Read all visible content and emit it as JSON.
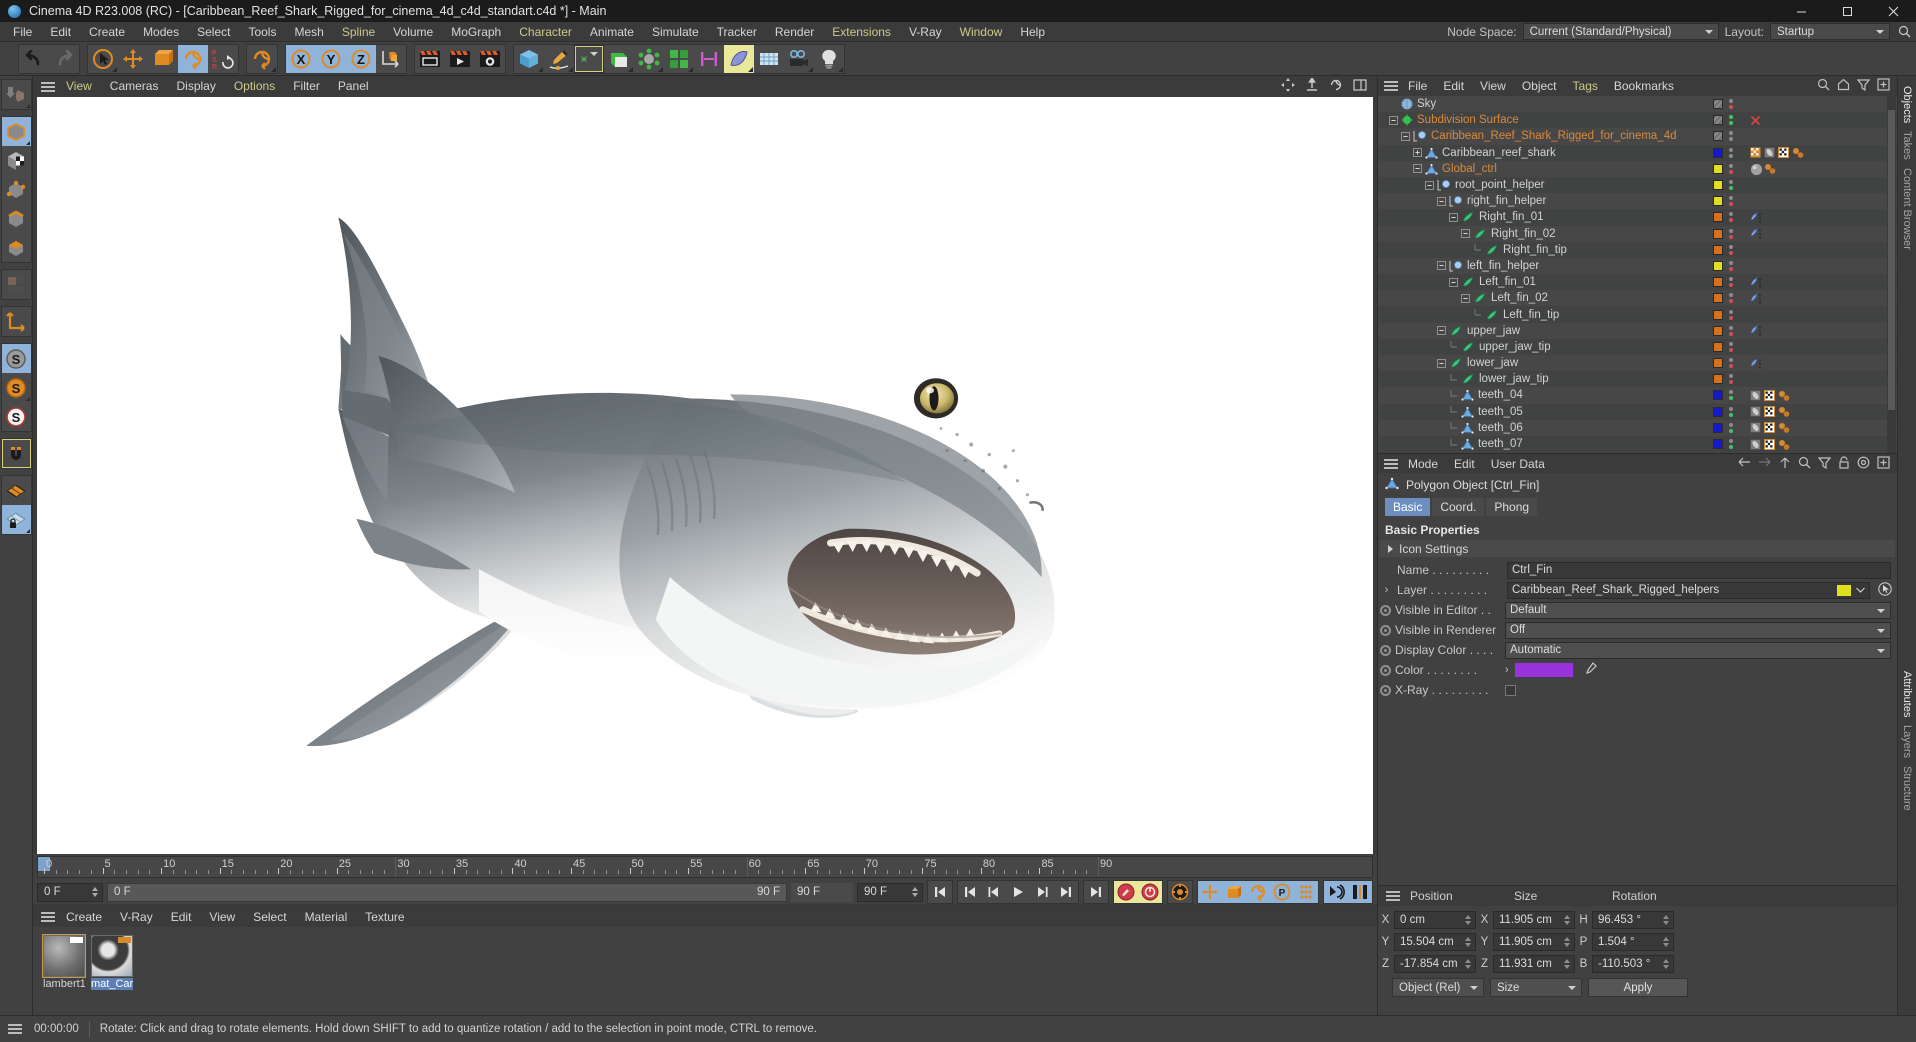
{
  "titlebar": {
    "title": "Cinema 4D R23.008 (RC) - [Caribbean_Reef_Shark_Rigged_for_cinema_4d_c4d_standart.c4d *] - Main",
    "minimize": "–",
    "maximize": "□",
    "close": "✕"
  },
  "menubar": {
    "items": [
      {
        "label": "File"
      },
      {
        "label": "Edit"
      },
      {
        "label": "Create"
      },
      {
        "label": "Modes"
      },
      {
        "label": "Select"
      },
      {
        "label": "Tools"
      },
      {
        "label": "Mesh"
      },
      {
        "label": "Spline",
        "accent": true
      },
      {
        "label": "Volume"
      },
      {
        "label": "MoGraph"
      },
      {
        "label": "Character",
        "accent": true
      },
      {
        "label": "Animate"
      },
      {
        "label": "Simulate"
      },
      {
        "label": "Tracker"
      },
      {
        "label": "Render"
      },
      {
        "label": "Extensions",
        "accent": true
      },
      {
        "label": "V-Ray"
      },
      {
        "label": "Window",
        "accent": true
      },
      {
        "label": "Help"
      }
    ],
    "node_space_label": "Node Space:",
    "node_space_value": "Current (Standard/Physical)",
    "layout_label": "Layout:",
    "layout_value": "Startup"
  },
  "toolbar": {
    "groups": [
      {
        "buttons": [
          {
            "name": "undo-icon",
            "state": "normal"
          },
          {
            "name": "redo-icon",
            "state": "disabled"
          }
        ]
      },
      {
        "buttons": [
          {
            "name": "select-live-icon",
            "state": "corner"
          },
          {
            "name": "move-icon",
            "state": "normal"
          },
          {
            "name": "scale-icon",
            "state": "normal"
          },
          {
            "name": "rotate-icon",
            "state": "on"
          },
          {
            "name": "psr-icon",
            "state": "normal"
          }
        ]
      },
      {
        "buttons": [
          {
            "name": "world-object-axis-icon",
            "state": "corner"
          }
        ]
      },
      {
        "buttons": [
          {
            "name": "x-axis-lock-icon",
            "state": "on"
          },
          {
            "name": "y-axis-lock-icon",
            "state": "on"
          },
          {
            "name": "z-axis-lock-icon",
            "state": "on"
          },
          {
            "name": "world-coordinate-icon",
            "state": "normal"
          }
        ]
      },
      {
        "buttons": [
          {
            "name": "render-view-icon",
            "state": "normal"
          },
          {
            "name": "render-to-picture-viewer-icon",
            "state": "normal"
          },
          {
            "name": "render-settings-icon",
            "state": "normal"
          }
        ]
      },
      {
        "buttons": [
          {
            "name": "cube-primitive-icon",
            "state": "corner"
          },
          {
            "name": "spline-pen-icon",
            "state": "corner"
          },
          {
            "name": "generator-icon",
            "state": "selected"
          },
          {
            "name": "bend-deformer-icon",
            "state": "corner"
          },
          {
            "name": "scene-objects-icon",
            "state": "corner"
          },
          {
            "name": "mograph-cloner-icon",
            "state": "corner"
          },
          {
            "name": "measure-icon",
            "state": "normal"
          },
          {
            "name": "deformer-icon",
            "state": "ony"
          },
          {
            "name": "floor-environment-icon",
            "state": "normal"
          },
          {
            "name": "camera-icon",
            "state": "corner"
          },
          {
            "name": "light-icon",
            "state": "corner"
          }
        ]
      }
    ]
  },
  "leftbar": {
    "groups": [
      {
        "buttons": [
          {
            "name": "make-editable-icon",
            "state": "corner"
          }
        ]
      },
      {
        "buttons": [
          {
            "name": "model-mode-icon",
            "state": "on"
          },
          {
            "name": "texture-mode-icon",
            "state": "normal"
          },
          {
            "name": "point-mode-icon",
            "state": "normal"
          },
          {
            "name": "edge-mode-icon",
            "state": "normal"
          },
          {
            "name": "polygon-mode-icon",
            "state": "normal"
          }
        ]
      },
      {
        "buttons": [
          {
            "name": "uv-mode-icon",
            "state": "disabled"
          }
        ]
      },
      {
        "buttons": [
          {
            "name": "axis-modify-icon",
            "state": "normal"
          }
        ]
      },
      {
        "buttons": [
          {
            "name": "enable-snap-gray-icon",
            "state": "on"
          },
          {
            "name": "snap-settings-icon",
            "state": "corner"
          },
          {
            "name": "snap-3d-icon",
            "state": "normal"
          }
        ]
      },
      {
        "buttons": [
          {
            "name": "magnet-icon",
            "state": "selected"
          }
        ]
      },
      {
        "buttons": [
          {
            "name": "workplane-icon",
            "state": "normal"
          },
          {
            "name": "lock-workplane-icon",
            "state": "on"
          }
        ]
      }
    ]
  },
  "viewport": {
    "menu": [
      {
        "label": "View",
        "accent": true
      },
      {
        "label": "Cameras"
      },
      {
        "label": "Display"
      },
      {
        "label": "Options",
        "accent": true
      },
      {
        "label": "Filter"
      },
      {
        "label": "Panel"
      }
    ],
    "nav_icons": [
      "pan-icon",
      "zoom-icon",
      "orbit-icon",
      "maximize-view-icon"
    ],
    "background": "#ffffff",
    "subject": "Caribbean reef shark 3D model"
  },
  "timeline": {
    "min_frame": 0,
    "max_frame": 90,
    "current_frame": 0,
    "tick_labels": [
      0,
      5,
      10,
      15,
      20,
      25,
      30,
      35,
      40,
      45,
      50,
      55,
      60,
      65,
      70,
      75,
      80,
      85,
      90
    ],
    "start_field": "0 F",
    "preview_start": "0 F",
    "preview_end": "90 F",
    "end_field": "90 F",
    "range_end": "90 F",
    "buttons": [
      {
        "name": "go-to-start-button",
        "glyph": "start"
      },
      {
        "name": "go-to-previous-key-button",
        "glyph": "prevkey"
      },
      {
        "name": "step-back-button",
        "glyph": "stepback"
      },
      {
        "name": "play-button",
        "glyph": "play"
      },
      {
        "name": "step-forward-button",
        "glyph": "stepfwd"
      },
      {
        "name": "go-to-next-key-button",
        "glyph": "nextkey"
      },
      {
        "name": "go-to-end-button",
        "glyph": "end"
      }
    ],
    "record_buttons": [
      {
        "name": "record-active-objects-button",
        "state": "ony"
      },
      {
        "name": "autokeying-button",
        "state": "ony"
      },
      {
        "name": "keyframe-selection-button",
        "state": "normal"
      },
      {
        "name": "position-key-button",
        "state": "on"
      },
      {
        "name": "scale-key-button",
        "state": "on"
      },
      {
        "name": "rotation-key-button",
        "state": "on"
      },
      {
        "name": "param-key-button",
        "state": "on"
      },
      {
        "name": "point-level-animation-button",
        "state": "on"
      }
    ],
    "right_buttons": [
      {
        "name": "animation-mode-button"
      },
      {
        "name": "timeline-toggle-button"
      }
    ]
  },
  "material_manager": {
    "menu": [
      "Create",
      "V-Ray",
      "Edit",
      "View",
      "Select",
      "Material",
      "Texture"
    ],
    "materials": [
      {
        "name": "lambert1",
        "selected_border": true,
        "selected_name": false
      },
      {
        "name": "mat_Car",
        "selected_border": false,
        "selected_name": true
      }
    ]
  },
  "object_manager": {
    "menu": [
      "File",
      "Edit",
      "View",
      "Object",
      "Tags",
      "Bookmarks"
    ],
    "menu_accent_index": 4,
    "right_icons": [
      "search-icon",
      "home-icon",
      "filter-icon",
      "add-layer-icon"
    ],
    "items": [
      {
        "label": "Sky",
        "indent": 0,
        "icon": "sky-icon",
        "expander": "none",
        "color": "none",
        "dots": [
          "gray",
          "red"
        ],
        "orange": false,
        "tags": [],
        "visdot": true
      },
      {
        "label": "Subdivision Surface",
        "indent": 0,
        "icon": "subdivision-icon",
        "expander": "minus",
        "color": "none",
        "dots": [
          "green",
          "green"
        ],
        "orange": true,
        "tags": [
          "red-x"
        ],
        "visdot": true
      },
      {
        "label": "Caribbean_Reef_Shark_Rigged_for_cinema_4d",
        "indent": 1,
        "icon": "null-icon",
        "expander": "minus",
        "color": "none",
        "dots": [
          "gray",
          "gray"
        ],
        "orange": true,
        "tags": [],
        "visdot": true
      },
      {
        "label": "Caribbean_reef_shark",
        "indent": 2,
        "icon": "polygon-icon",
        "expander": "plus",
        "color": "#1818c8",
        "dots": [
          "gray",
          "gray"
        ],
        "orange": false,
        "tags": [
          "vray-tag",
          "phong-tag",
          "uv-tag",
          "material-tag"
        ]
      },
      {
        "label": "Global_ctrl",
        "indent": 2,
        "icon": "polygon-icon",
        "expander": "minus",
        "color": "#e0e020",
        "dots": [
          "gray",
          "red"
        ],
        "orange": true,
        "tags": [
          "material-ball",
          "material-tag"
        ]
      },
      {
        "label": "root_point_helper",
        "indent": 3,
        "icon": "null-icon",
        "expander": "minus",
        "color": "#e0e020",
        "dots": [
          "gray",
          "green"
        ],
        "orange": false,
        "tags": []
      },
      {
        "label": "right_fin_helper",
        "indent": 4,
        "icon": "null-icon",
        "expander": "minus",
        "color": "#e0e020",
        "dots": [
          "gray",
          "red"
        ],
        "orange": false,
        "tags": []
      },
      {
        "label": "Right_fin_01",
        "indent": 5,
        "icon": "joint-icon",
        "expander": "minus",
        "color": "#d4711e",
        "dots": [
          "gray",
          "red"
        ],
        "orange": false,
        "tags": [
          "psr-tag"
        ]
      },
      {
        "label": "Right_fin_02",
        "indent": 6,
        "icon": "joint-icon",
        "expander": "minus",
        "color": "#d4711e",
        "dots": [
          "gray",
          "red"
        ],
        "orange": false,
        "tags": [
          "psr-tag"
        ]
      },
      {
        "label": "Right_fin_tip",
        "indent": 7,
        "icon": "joint-icon",
        "expander": "end",
        "color": "#d4711e",
        "dots": [
          "gray",
          "red"
        ],
        "orange": false,
        "tags": []
      },
      {
        "label": "left_fin_helper",
        "indent": 4,
        "icon": "null-icon",
        "expander": "minus",
        "color": "#e0e020",
        "dots": [
          "gray",
          "red"
        ],
        "orange": false,
        "tags": []
      },
      {
        "label": "Left_fin_01",
        "indent": 5,
        "icon": "joint-icon",
        "expander": "minus",
        "color": "#d4711e",
        "dots": [
          "gray",
          "red"
        ],
        "orange": false,
        "tags": [
          "psr-tag"
        ]
      },
      {
        "label": "Left_fin_02",
        "indent": 6,
        "icon": "joint-icon",
        "expander": "minus",
        "color": "#d4711e",
        "dots": [
          "gray",
          "red"
        ],
        "orange": false,
        "tags": [
          "psr-tag"
        ]
      },
      {
        "label": "Left_fin_tip",
        "indent": 7,
        "icon": "joint-icon",
        "expander": "end",
        "color": "#d4711e",
        "dots": [
          "gray",
          "red"
        ],
        "orange": false,
        "tags": []
      },
      {
        "label": "upper_jaw",
        "indent": 4,
        "icon": "joint-icon",
        "expander": "minus",
        "color": "#d4711e",
        "dots": [
          "gray",
          "red"
        ],
        "orange": false,
        "tags": [
          "psr-tag"
        ]
      },
      {
        "label": "upper_jaw_tip",
        "indent": 5,
        "icon": "joint-icon",
        "expander": "branch",
        "color": "#d4711e",
        "dots": [
          "gray",
          "red"
        ],
        "orange": false,
        "tags": []
      },
      {
        "label": "lower_jaw",
        "indent": 4,
        "icon": "joint-icon",
        "expander": "minus",
        "color": "#d4711e",
        "dots": [
          "gray",
          "red"
        ],
        "orange": false,
        "tags": [
          "psr-tag"
        ]
      },
      {
        "label": "lower_jaw_tip",
        "indent": 5,
        "icon": "joint-icon",
        "expander": "branch",
        "color": "#d4711e",
        "dots": [
          "gray",
          "red"
        ],
        "orange": false,
        "tags": []
      },
      {
        "label": "teeth_04",
        "indent": 5,
        "icon": "polygon-icon",
        "expander": "branch",
        "color": "#1818c8",
        "dots": [
          "gray",
          "green"
        ],
        "orange": false,
        "tags": [
          "phong-tag",
          "uv-tag",
          "material-tag"
        ]
      },
      {
        "label": "teeth_05",
        "indent": 5,
        "icon": "polygon-icon",
        "expander": "branch",
        "color": "#1818c8",
        "dots": [
          "gray",
          "green"
        ],
        "orange": false,
        "tags": [
          "phong-tag",
          "uv-tag",
          "material-tag"
        ]
      },
      {
        "label": "teeth_06",
        "indent": 5,
        "icon": "polygon-icon",
        "expander": "branch",
        "color": "#1818c8",
        "dots": [
          "gray",
          "green"
        ],
        "orange": false,
        "tags": [
          "phong-tag",
          "uv-tag",
          "material-tag"
        ]
      },
      {
        "label": "teeth_07",
        "indent": 5,
        "icon": "polygon-icon",
        "expander": "branch",
        "color": "#1818c8",
        "dots": [
          "gray",
          "green"
        ],
        "orange": false,
        "tags": [
          "phong-tag",
          "uv-tag",
          "material-tag"
        ]
      }
    ]
  },
  "attributes": {
    "menu": [
      "Mode",
      "Edit",
      "User Data"
    ],
    "right_icons": [
      "back-arrow-icon",
      "forward-arrow-icon",
      "up-arrow-icon",
      "search-icon",
      "filter-icon",
      "lock-icon",
      "pin-icon",
      "add-icon"
    ],
    "object_title": "Polygon Object [Ctrl_Fin]",
    "tabs": [
      {
        "label": "Basic",
        "active": true
      },
      {
        "label": "Coord.",
        "active": false
      },
      {
        "label": "Phong",
        "active": false
      }
    ],
    "section_title": "Basic Properties",
    "icon_settings_label": "Icon Settings",
    "fields": [
      {
        "label": "Name . . . . . . . . .",
        "value": "Ctrl_Fin",
        "type": "text",
        "name": "name-field"
      },
      {
        "label": "Layer . . . . . . . . .",
        "value": "Caribbean_Reef_Shark_Rigged_helpers",
        "type": "layer",
        "name": "layer-field",
        "swatch": "#e0e020"
      },
      {
        "label": "Visible in Editor  . .",
        "value": "Default",
        "type": "dropdown",
        "name": "visible-in-editor-dropdown"
      },
      {
        "label": "Visible in Renderer",
        "value": "Off",
        "type": "dropdown",
        "name": "visible-in-renderer-dropdown"
      },
      {
        "label": "Display Color . . . .",
        "value": "Automatic",
        "type": "dropdown",
        "name": "display-color-dropdown"
      },
      {
        "label": "Color . . . . . . . .",
        "value": "#9933dd",
        "type": "color",
        "name": "color-swatch"
      },
      {
        "label": "X-Ray . . . . . . . . .",
        "value": "",
        "type": "checkbox",
        "name": "x-ray-checkbox"
      }
    ]
  },
  "coordinates": {
    "headers": [
      "Position",
      "Size",
      "Rotation"
    ],
    "rows": [
      {
        "axis1": "X",
        "pos": "0 cm",
        "axis2": "X",
        "size": "11.905 cm",
        "axis3": "H",
        "rot": "96.453 °"
      },
      {
        "axis1": "Y",
        "pos": "15.504 cm",
        "axis2": "Y",
        "size": "11.905 cm",
        "axis3": "P",
        "rot": "1.504 °"
      },
      {
        "axis1": "Z",
        "pos": "-17.854 cm",
        "axis2": "Z",
        "size": "11.931 cm",
        "axis3": "B",
        "rot": "-110.503 °"
      }
    ],
    "mode_dropdown": "Object (Rel)",
    "size_dropdown": "Size",
    "apply_button": "Apply"
  },
  "side_tabs_top": [
    {
      "label": "Objects",
      "active": true
    },
    {
      "label": "Takes",
      "active": false
    },
    {
      "label": "Content Browser",
      "active": false
    }
  ],
  "side_tabs_bottom": [
    {
      "label": "Attributes",
      "active": true
    },
    {
      "label": "Layers",
      "active": false
    },
    {
      "label": "Structure",
      "active": false
    }
  ],
  "statusbar": {
    "time": "00:00:00",
    "message": "Rotate: Click and drag to rotate elements. Hold down SHIFT to add to quantize rotation / add to the selection in point mode, CTRL to remove."
  }
}
